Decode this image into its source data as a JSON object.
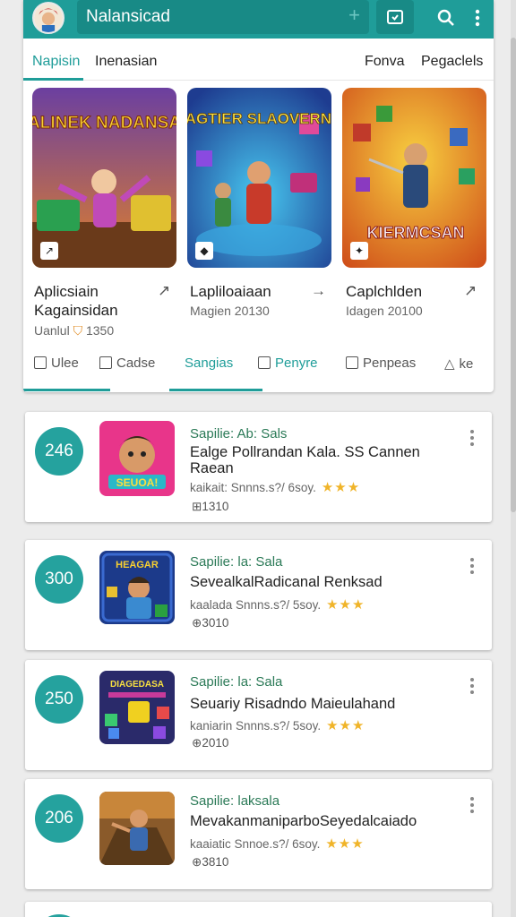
{
  "header": {
    "search_value": "Nalansicad",
    "tabs": [
      "Napisin",
      "Inenasian",
      "Fonva",
      "Pegaclels"
    ]
  },
  "featured": [
    {
      "banner": "KALINEK NADANSAX",
      "title1": "Aplicsiain",
      "title2": "Kagainsidan",
      "meta": "Uanlul",
      "meta_value": "1350"
    },
    {
      "banner": "VAGTIER SLAOVERNE",
      "title1": "Lapliloaiaan",
      "title2": "",
      "meta": "Magien 20130",
      "meta_value": ""
    },
    {
      "banner": "KIERMCSAN",
      "title1": "Caplchlden",
      "title2": "",
      "meta": "Idagen 20100",
      "meta_value": ""
    }
  ],
  "categories": [
    "Ulee",
    "Cadse",
    "Sangias",
    "Penyre",
    "Penpeas",
    "ke"
  ],
  "apps": [
    {
      "rank": "246",
      "category": "Sapilie: Ab: Sals",
      "title": "Ealge Pollrandan Kala. SS Cannen Raean",
      "meta": "kaikait: Snnns.s?/ 6soy.",
      "stars": "★★★",
      "size": "1310",
      "thumb_text": "SEUOA!"
    },
    {
      "rank": "300",
      "category": "Sapilie: la: Sala",
      "title": "SevealkalRadicanal Renksad",
      "meta": "kaalada Snnns.s?/ 5soy.",
      "stars": "★★★",
      "size": "3010",
      "thumb_text": "HEAGAR"
    },
    {
      "rank": "250",
      "category": "Sapilie: la: Sala",
      "title": "Seuariy Risadndo Maieulahand",
      "meta": "kaniarin Snnns.s?/ 5soy.",
      "stars": "★★★",
      "size": "2010",
      "thumb_text": "DIAGEDASA"
    },
    {
      "rank": "206",
      "category": "Sapilie: laksala",
      "title": "MevakanmaniparboSeyedalcaiado",
      "meta": "kaaiatic Snnoe.s?/ 6soy.",
      "stars": "★★★",
      "size": "3810",
      "thumb_text": ""
    }
  ],
  "colors": {
    "accent": "#1f9d99",
    "accent_dark": "#188a86",
    "star": "#f0b429"
  }
}
